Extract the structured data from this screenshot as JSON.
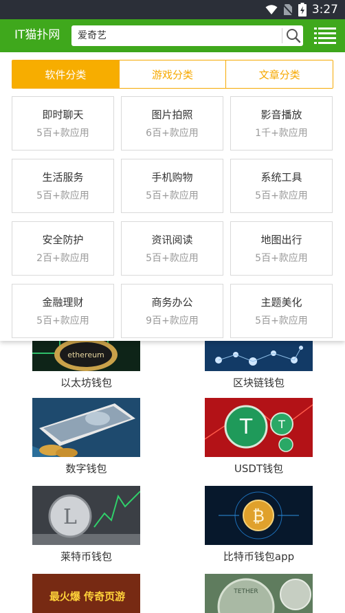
{
  "status_bar": {
    "time": "3:27"
  },
  "header": {
    "brand": "IT猫扑网",
    "search_placeholder": "爱奇艺"
  },
  "tabs": [
    {
      "label": "软件分类",
      "active": true
    },
    {
      "label": "游戏分类",
      "active": false
    },
    {
      "label": "文章分类",
      "active": false
    }
  ],
  "categories": [
    {
      "name": "即时聊天",
      "count": "5百+款应用"
    },
    {
      "name": "图片拍照",
      "count": "6百+款应用"
    },
    {
      "name": "影音播放",
      "count": "1千+款应用"
    },
    {
      "name": "生活服务",
      "count": "5百+款应用"
    },
    {
      "name": "手机购物",
      "count": "5百+款应用"
    },
    {
      "name": "系统工具",
      "count": "5百+款应用"
    },
    {
      "name": "安全防护",
      "count": "2百+款应用"
    },
    {
      "name": "资讯阅读",
      "count": "5百+款应用"
    },
    {
      "name": "地图出行",
      "count": "5百+款应用"
    },
    {
      "name": "金融理财",
      "count": "5百+款应用"
    },
    {
      "name": "商务办公",
      "count": "9百+款应用"
    },
    {
      "name": "主题美化",
      "count": "5百+款应用"
    }
  ],
  "wallets": [
    {
      "label": "以太坊钱包",
      "image_text": "ethereum"
    },
    {
      "label": "区块链钱包"
    },
    {
      "label": "数字钱包"
    },
    {
      "label": "USDT钱包"
    },
    {
      "label": "莱特币钱包"
    },
    {
      "label": "比特币钱包app"
    },
    {
      "label": "",
      "image_text": "最火爆 传奇页游"
    },
    {
      "label": "",
      "image_text": "TETHER"
    }
  ],
  "colors": {
    "header_green": "#3fa81c",
    "accent_orange": "#f7ad00",
    "status_bar": "#2b2f38"
  }
}
